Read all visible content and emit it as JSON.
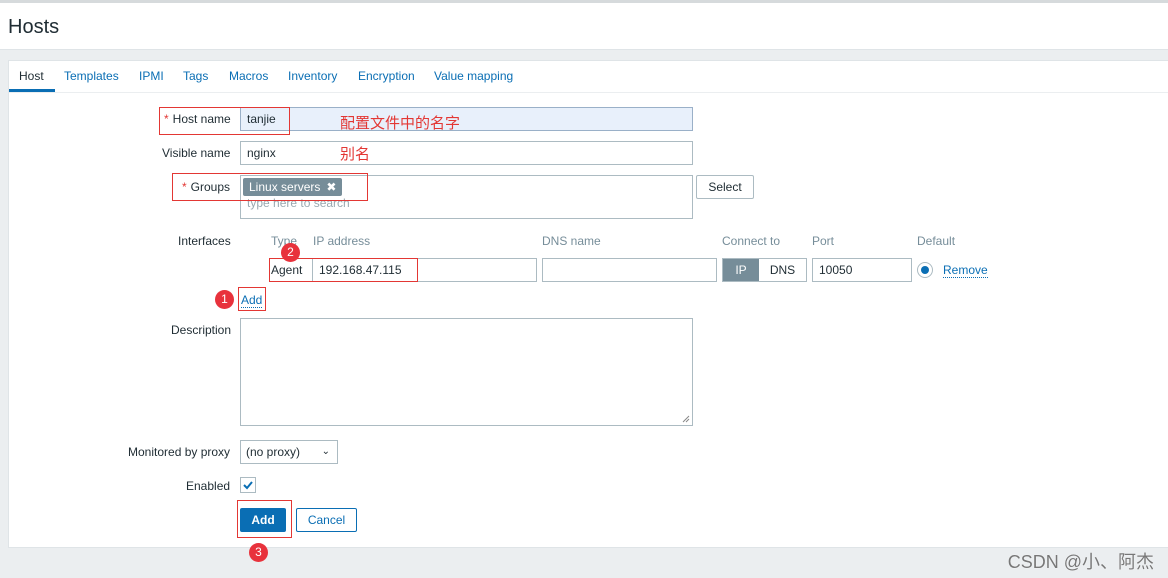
{
  "header": {
    "title": "Hosts"
  },
  "tabs": [
    {
      "label": "Host",
      "active": true
    },
    {
      "label": "Templates"
    },
    {
      "label": "IPMI"
    },
    {
      "label": "Tags"
    },
    {
      "label": "Macros"
    },
    {
      "label": "Inventory"
    },
    {
      "label": "Encryption"
    },
    {
      "label": "Value mapping"
    }
  ],
  "form": {
    "required_mark": "*",
    "host_name": {
      "label": "Host name",
      "value": "tanjie"
    },
    "visible_name": {
      "label": "Visible name",
      "value": "nginx"
    },
    "groups": {
      "label": "Groups",
      "chips": [
        {
          "label": "Linux servers",
          "remove_glyph": "✖"
        }
      ],
      "placeholder": "type here to search",
      "select_button": "Select"
    },
    "interfaces": {
      "label": "Interfaces",
      "columns": [
        "Type",
        "IP address",
        "DNS name",
        "Connect to",
        "Port",
        "Default"
      ],
      "rows": [
        {
          "type": "Agent",
          "ip": "192.168.47.115",
          "dns": "",
          "connect_options": [
            "IP",
            "DNS"
          ],
          "connect_selected": "IP",
          "port": "10050",
          "default": true,
          "remove_label": "Remove"
        }
      ],
      "add_label": "Add"
    },
    "description": {
      "label": "Description",
      "value": ""
    },
    "proxy": {
      "label": "Monitored by proxy",
      "selected": "(no proxy)"
    },
    "enabled": {
      "label": "Enabled",
      "checked": true
    },
    "buttons": {
      "add": "Add",
      "cancel": "Cancel"
    }
  },
  "annotations": {
    "host_name_note": "配置文件中的名字",
    "visible_name_note": "别名",
    "badges": [
      "1",
      "2",
      "3"
    ]
  },
  "colors": {
    "accent": "#0a6eb4",
    "annotation": "#e33734",
    "chip": "#768d99"
  },
  "watermark": "CSDN @小、阿杰"
}
